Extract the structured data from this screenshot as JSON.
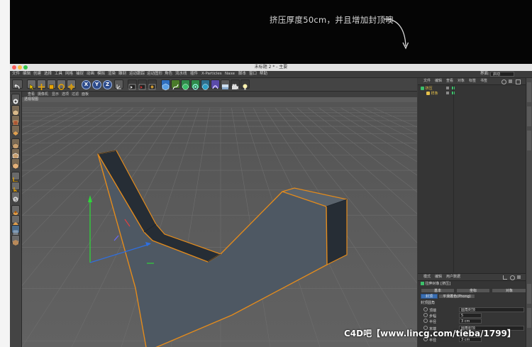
{
  "banner": {
    "caption": "挤压厚度50cm，并且增加封顶噢"
  },
  "window": {
    "title": "未标题 2 * - 主要"
  },
  "menubar": {
    "items": [
      "文件",
      "编辑",
      "创建",
      "选择",
      "工具",
      "网格",
      "捕捉",
      "动画",
      "模拟",
      "渲染",
      "雕刻",
      "运动跟踪",
      "运动图形",
      "角色",
      "流水线",
      "插件",
      "X-Particles",
      "Naxe",
      "脚本",
      "窗口",
      "帮助"
    ],
    "layout_label": "界面:",
    "layout_value": "启动"
  },
  "toolbar": {
    "axis_labels": [
      "X",
      "Y",
      "Z"
    ]
  },
  "viewport": {
    "menu": [
      "查看",
      "摄像机",
      "显示",
      "选项",
      "过滤",
      "面板"
    ],
    "camera_label": "透视视图"
  },
  "object_manager": {
    "tabs": [
      "文件",
      "编辑",
      "查看",
      "对象",
      "标签",
      "书签"
    ],
    "objects": [
      {
        "name": "挤压",
        "color": "#e6c14a"
      },
      {
        "name": "样条",
        "color": "#e6c14a"
      }
    ]
  },
  "attribute_manager": {
    "tabs": [
      "模式",
      "编辑",
      "用户数据"
    ],
    "object_title": "拉伸对象 [挤压]",
    "section_tabs": [
      "基本",
      "坐标",
      "对象"
    ],
    "sub_tabs": [
      "封顶",
      "平滑着色(Phong)"
    ],
    "section_header": "封顶圆角",
    "rows": [
      {
        "label": "顶端",
        "value": "圆角封顶"
      },
      {
        "label": "步幅",
        "value": "5"
      },
      {
        "label": "半径",
        "value": "3 cm"
      },
      {
        "label": "末端",
        "value": "圆角封顶"
      },
      {
        "label": "半径",
        "value": "3 cm"
      }
    ]
  },
  "watermark": {
    "text": "C4D吧【www.lincg.com/tieba/1799】"
  },
  "colors": {
    "banner_bg": "#050505",
    "viewport_bg": "#5a5a5a",
    "shape_face": "#4e5863",
    "shape_outline": "#e38b1c"
  }
}
